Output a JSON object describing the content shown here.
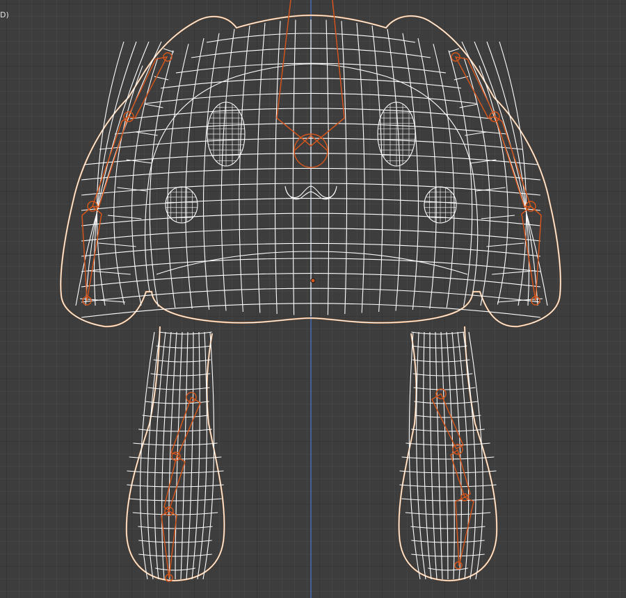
{
  "viewport": {
    "overlay_text": "D)",
    "colors": {
      "background": "#3d3d3d",
      "wire": "#ffffff",
      "outline": "#f4a261",
      "armature": "#d2551c",
      "axis_z": "#4a78d6",
      "origin": "#d2551c"
    },
    "icons": {
      "origin": "origin-point-icon"
    }
  }
}
